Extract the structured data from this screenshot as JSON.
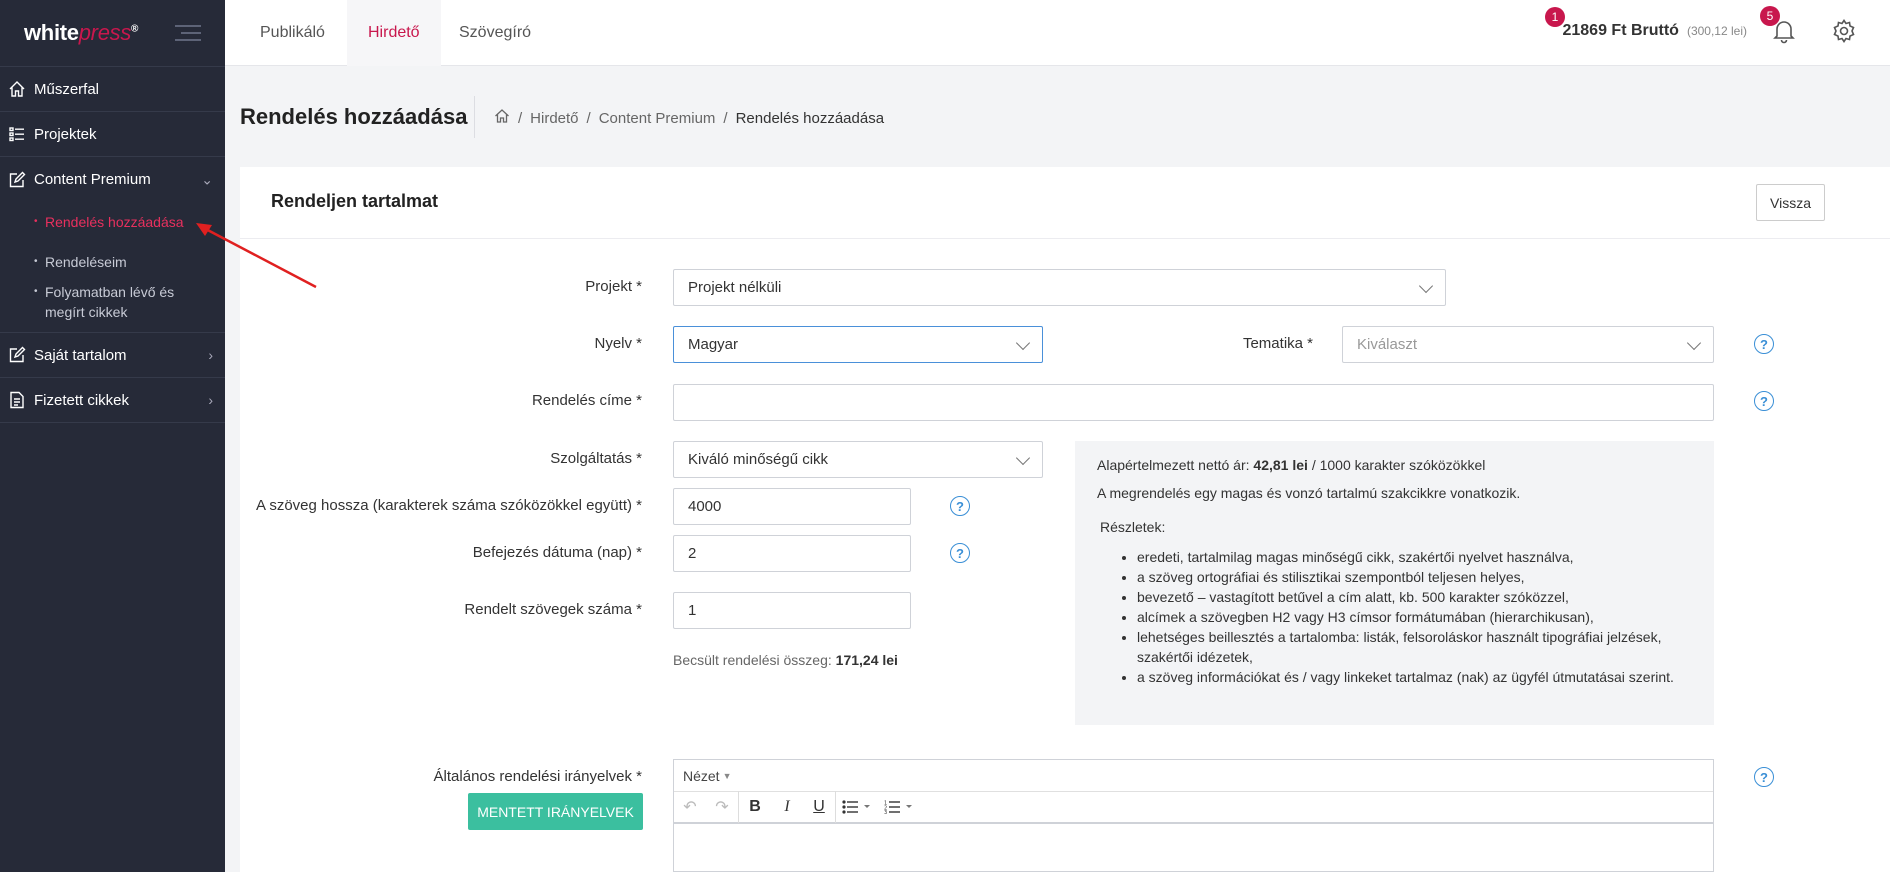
{
  "sidebar": {
    "logo_white": "white",
    "logo_press": "press",
    "logo_reg": "®",
    "items": [
      {
        "label": "Műszerfal",
        "icon": "home-icon"
      },
      {
        "label": "Projektek",
        "icon": "list-icon"
      },
      {
        "label": "Content Premium",
        "icon": "edit-icon"
      },
      {
        "label": "Saját tartalom",
        "icon": "edit-icon"
      },
      {
        "label": "Fizetett cikkek",
        "icon": "document-icon"
      }
    ],
    "submenu": [
      {
        "label": "Rendelés hozzáadása",
        "active": true
      },
      {
        "label": "Rendeléseim"
      },
      {
        "label": "Folyamatban lévő és megírt cikkek"
      }
    ]
  },
  "topbar": {
    "tabs": [
      "Publikáló",
      "Hirdető",
      "Szövegíró"
    ],
    "balance_badge": "1",
    "balance": "21869 Ft Bruttó",
    "balance_sub": "(300,12 lei)",
    "notif_badge": "5"
  },
  "page": {
    "title": "Rendelés hozzáadása",
    "breadcrumb": [
      "Hirdető",
      "Content Premium",
      "Rendelés hozzáadása"
    ]
  },
  "card": {
    "title": "Rendeljen tartalmat",
    "back_label": "Vissza"
  },
  "form": {
    "project_label": "Projekt *",
    "project_value": "Projekt nélküli",
    "language_label": "Nyelv *",
    "language_value": "Magyar",
    "theme_label": "Tematika *",
    "theme_placeholder": "Kiválaszt",
    "order_title_label": "Rendelés címe *",
    "order_title_value": "",
    "service_label": "Szolgáltatás *",
    "service_value": "Kiváló minőségű cikk",
    "length_label": "A szöveg hossza (karakterek száma szóközökkel együtt) *",
    "length_value": "4000",
    "deadline_label": "Befejezés dátuma (nap) *",
    "deadline_value": "2",
    "count_label": "Rendelt szövegek száma *",
    "count_value": "1",
    "estimate_prefix": "Becsült rendelési összeg:",
    "estimate_value": "171,24 lei",
    "guidelines_label": "Általános rendelési irányelvek *",
    "saved_guidelines_btn": "MENTETT IRÁNYELVEK",
    "editor_view_menu": "Nézet"
  },
  "info": {
    "price_prefix": "Alapértelmezett nettó ár:",
    "price_value": "42,81 lei",
    "price_suffix": "/ 1000 karakter szóközökkel",
    "description": "A megrendelés egy magas és vonzó tartalmú szakcikkre vonatkozik.",
    "details_title": "Részletek:",
    "details": [
      "eredeti, tartalmilag magas minőségű cikk, szakértői nyelvet használva,",
      "a szöveg ortográfiai és stilisztikai szempontból teljesen helyes,",
      "bevezető – vastagított betűvel a cím alatt, kb. 500 karakter szóközzel,",
      "alcímek a szövegben H2 vagy H3 címsor formátumában (hierarchikusan),",
      "lehetséges beillesztés a tartalomba: listák, felsoroláskor használt tipográfiai jelzések, szakértői idézetek,",
      "a szöveg információkat és / vagy linkeket tartalmaz (nak) az ügyfél útmutatásai szerint."
    ]
  },
  "colors": {
    "brand": "#c8174d",
    "sidebar_bg": "#262a38",
    "accent_green": "#3bbf9f",
    "help_blue": "#3a8fd6"
  }
}
